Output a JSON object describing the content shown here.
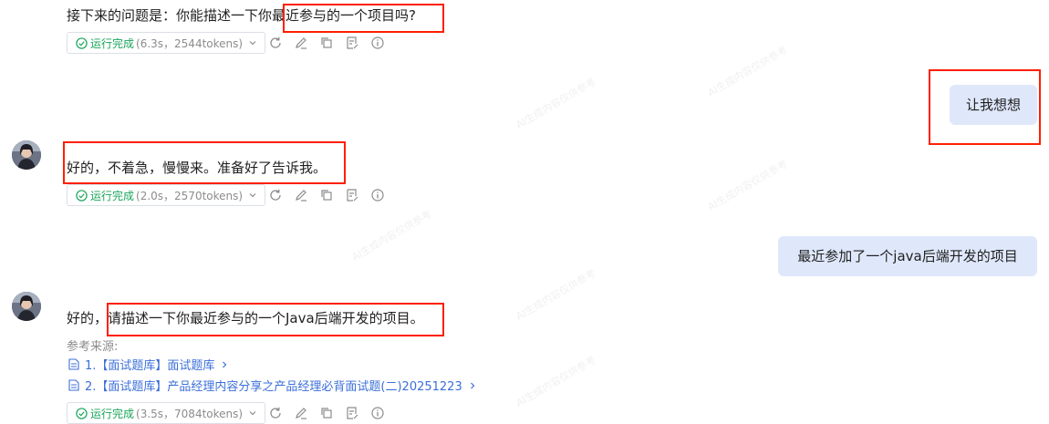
{
  "messages": [
    {
      "role": "assistant",
      "text": "接下来的问题是：你能描述一下你最近参与的一个项目吗?",
      "status": {
        "label": "运行完成",
        "meta": "(6.3s，2544tokens)"
      }
    },
    {
      "role": "user",
      "text": "让我想想"
    },
    {
      "role": "assistant",
      "text": "好的，不着急，慢慢来。准备好了告诉我。",
      "status": {
        "label": "运行完成",
        "meta": "(2.0s，2570tokens)"
      }
    },
    {
      "role": "user",
      "text": "最近参加了一个java后端开发的项目"
    },
    {
      "role": "assistant",
      "text": "好的，请描述一下你最近参与的一个Java后端开发的项目。",
      "refs_title": "参考来源:",
      "refs": [
        {
          "label": "1.【面试题库】面试题库"
        },
        {
          "label": "2.【面试题库】产品经理内容分享之产品经理必背面试题(二)20251223"
        }
      ],
      "status": {
        "label": "运行完成",
        "meta": "(3.5s，7084tokens)"
      }
    }
  ],
  "toolbar_icons": [
    "refresh-icon",
    "edit-icon",
    "copy-icon",
    "note-icon",
    "info-icon"
  ],
  "colors": {
    "success": "#19a55a",
    "link": "#3b6fd8",
    "user_bubble": "#dfe8fb",
    "highlight": "#ff1f00",
    "meta": "#8c8c8c"
  }
}
